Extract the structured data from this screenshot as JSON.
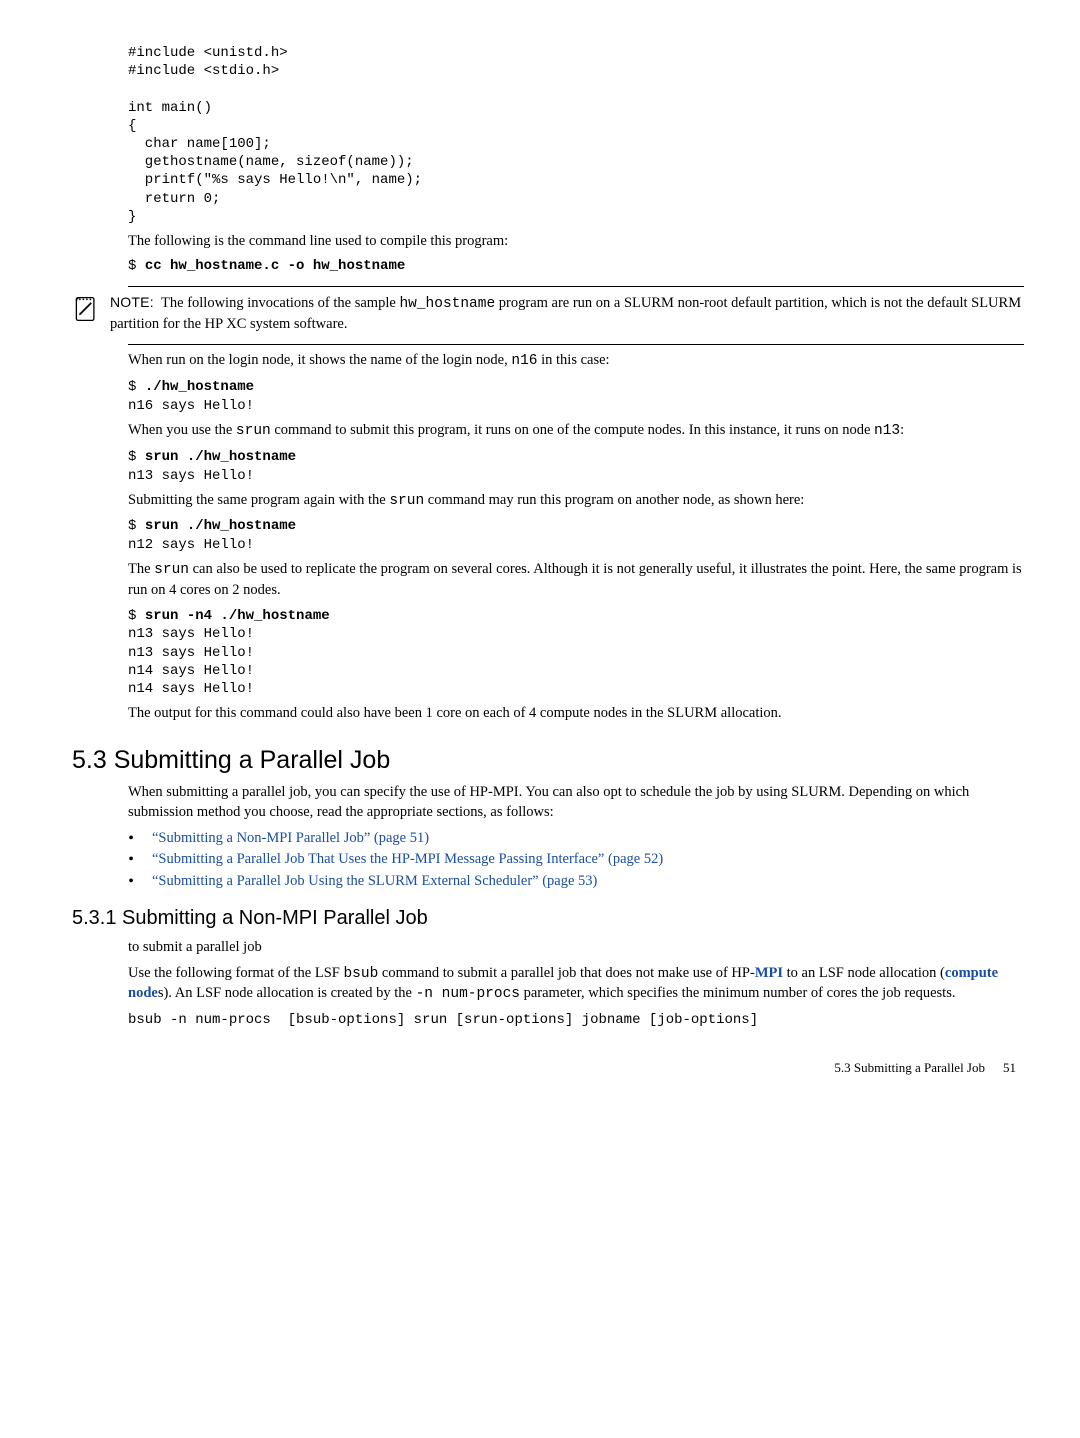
{
  "code_block1": "#include <unistd.h>\n#include <stdio.h>\n\nint main()\n{\n  char name[100];\n  gethostname(name, sizeof(name));\n  printf(\"%s says Hello!\\n\", name);\n  return 0;\n}",
  "para1": "The following is the command line used to compile this program:",
  "cmd1_prompt": "$ ",
  "cmd1_bold": "cc hw_hostname.c -o hw_hostname",
  "note": {
    "label": "NOTE:",
    "text_before": "The following invocations of the sample ",
    "code": "hw_hostname",
    "text_after": " program are run on a SLURM non-root default partition, which is not the default SLURM partition for the HP XC system software."
  },
  "para2_a": "When run on the login node, it shows the name of the login node, ",
  "para2_code": "n16",
  "para2_b": " in this case:",
  "cmd2_prompt": "$ ",
  "cmd2_bold": "./hw_hostname",
  "cmd2_out": "n16 says Hello!",
  "para3_a": "When you use the ",
  "para3_code1": "srun",
  "para3_b": " command to submit this program, it runs on one of the compute nodes. In this instance, it runs on node ",
  "para3_code2": "n13",
  "para3_c": ":",
  "cmd3_prompt": "$ ",
  "cmd3_bold": "srun ./hw_hostname",
  "cmd3_out": "n13 says Hello!",
  "para4_a": "Submitting the same program again with the ",
  "para4_code": "srun",
  "para4_b": " command may run this program on another node, as shown here:",
  "cmd4_prompt": "$ ",
  "cmd4_bold": "srun ./hw_hostname",
  "cmd4_out": "n12 says Hello!",
  "para5_a": "The ",
  "para5_code": "srun",
  "para5_b": " can also be used to replicate the program on several cores. Although it is not generally useful, it illustrates the point. Here, the same program is run on 4 cores on 2 nodes.",
  "cmd5_prompt": "$ ",
  "cmd5_bold": "srun -n4 ./hw_hostname",
  "cmd5_out": "n13 says Hello!\nn13 says Hello!\nn14 says Hello!\nn14 says Hello!",
  "para6": "The output for this command could also have been 1 core on each of 4 compute nodes in the SLURM allocation.",
  "h2": "5.3 Submitting a Parallel Job",
  "para7": "When submitting a parallel job, you can specify the use of HP-MPI. You can also opt to schedule the job by using SLURM. Depending on which submission method you choose, read the appropriate sections, as follows:",
  "bullets": [
    "“Submitting a Non-MPI Parallel Job” (page 51)",
    "“Submitting a Parallel Job That Uses the HP-MPI Message Passing Interface” (page 52)",
    "“Submitting a Parallel Job Using the SLURM External Scheduler” (page 53)"
  ],
  "h3": "5.3.1 Submitting a Non-MPI Parallel Job",
  "para8": "to submit a parallel job",
  "para9_a": "Use the following format of the LSF ",
  "para9_code1": "bsub",
  "para9_b": " command to submit a parallel job that does not make use of HP-",
  "para9_gloss1": "MPI",
  "para9_c": " to an LSF node allocation (",
  "para9_gloss2": "compute node",
  "para9_d": "s). An LSF node allocation is created by the ",
  "para9_code2": "-n num-procs",
  "para9_e": " parameter, which specifies the minimum number of cores the job requests.",
  "syntax": "bsub -n num-procs  [bsub-options] srun [srun-options] jobname [job-options]",
  "footer_left": "5.3 Submitting a Parallel Job",
  "footer_page": "51"
}
